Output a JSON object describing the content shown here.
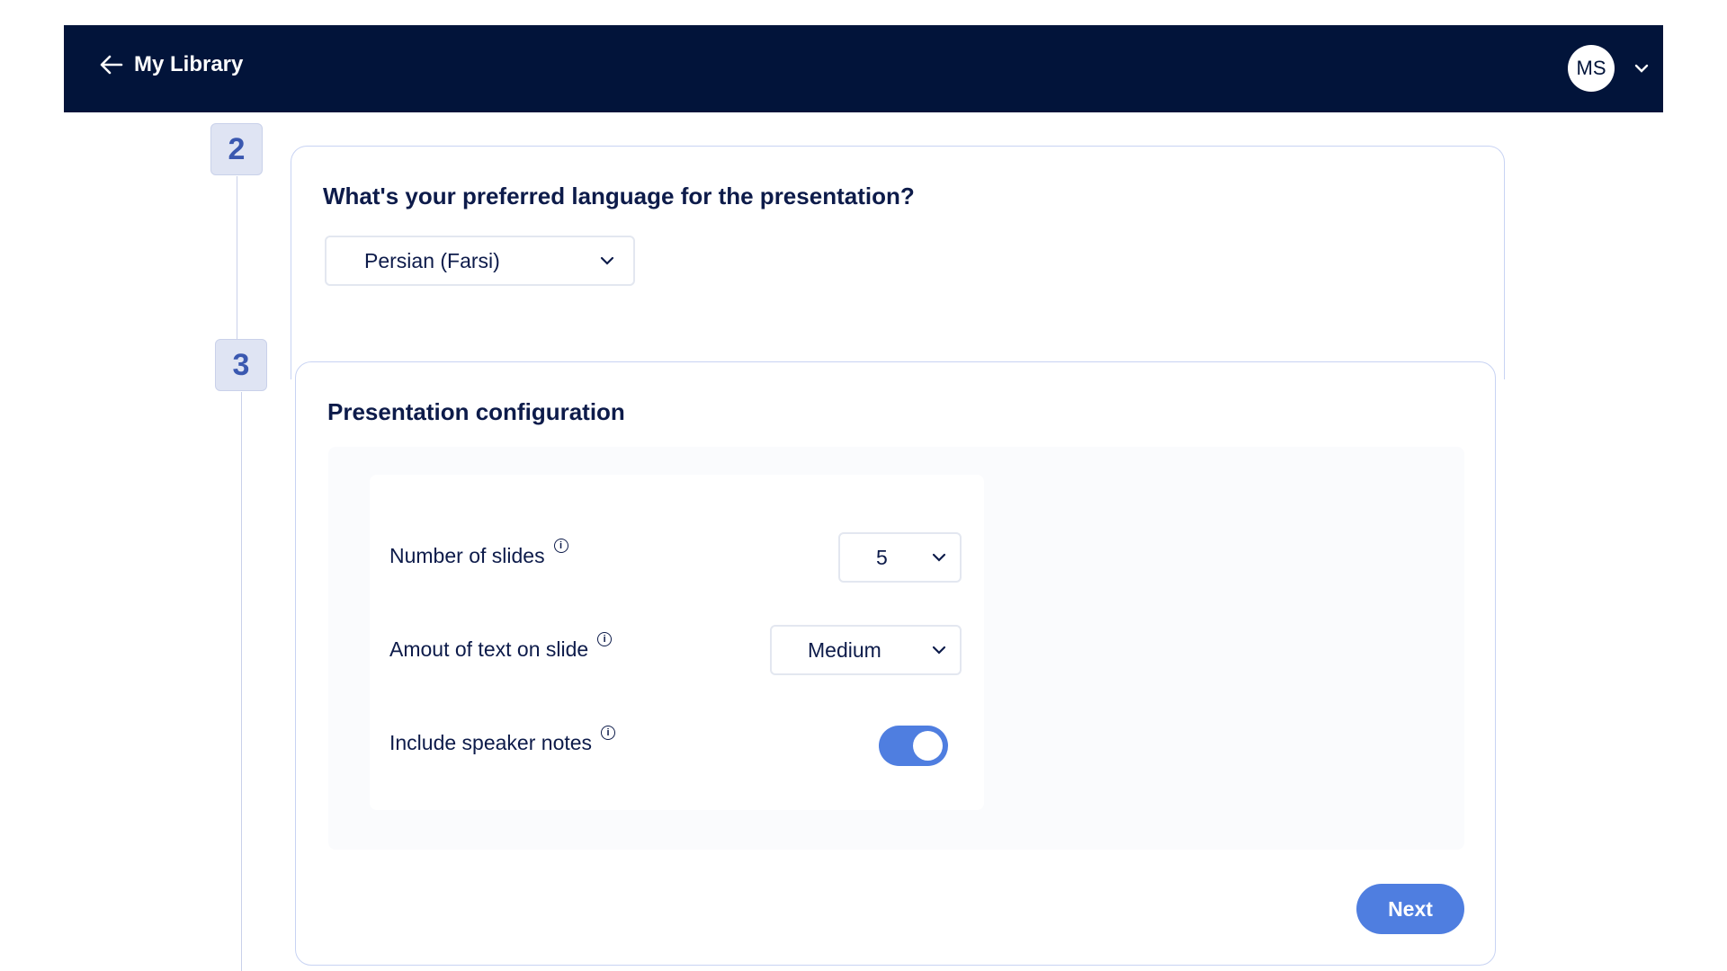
{
  "header": {
    "back_label": "My Library",
    "avatar_initials": "MS",
    "bg_color": "#02143a"
  },
  "steps": {
    "language_step_number": "2",
    "config_step_number": "3"
  },
  "language": {
    "question": "What's your preferred language for the presentation?",
    "selected": "Persian (Farsi)"
  },
  "config": {
    "title": "Presentation configuration",
    "slides_label": "Number of slides",
    "slides_value": "5",
    "text_amount_label": "Amout of text on slide",
    "text_amount_value": "Medium",
    "speaker_notes_label": "Include speaker notes",
    "speaker_notes_enabled": true,
    "info_glyph": "i"
  },
  "actions": {
    "next_label": "Next",
    "accent_color": "#4f7ee0"
  }
}
